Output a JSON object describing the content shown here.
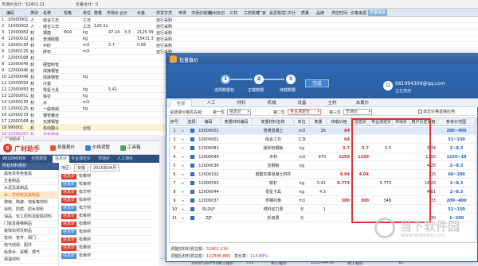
{
  "colors": {
    "accent": "#2d5a99",
    "highlight": "#e0342e",
    "red": "#d02424",
    "blue": "#1f5fbf"
  },
  "bg": {
    "status_left": "市场价合计：52401.21",
    "status_mid": "价差合计：0",
    "headers": [
      "",
      "编码",
      "类别",
      "名称",
      "规格",
      "单位",
      "数量",
      "市场价",
      "合价",
      "价差",
      "供货方式",
      "甲供",
      "市场价锁定",
      "输出标记",
      "三材",
      "三材系数",
      "厂家",
      "是否暂估",
      "二次分",
      "质量",
      "品牌",
      "供应时间",
      "价格来源"
    ],
    "highlight_header": "质量等级",
    "rows": [
      [
        "1",
        "10000001",
        "人",
        "综合工日",
        "",
        "工日",
        "",
        "",
        "",
        "",
        "自行采购"
      ],
      [
        "2",
        "11000002",
        "人",
        "综合工日",
        "",
        "工日",
        "120.31",
        "",
        "",
        "",
        "自行采购"
      ],
      [
        "3",
        "12000082",
        "材",
        "钢筋",
        "Φ10",
        "kg",
        "",
        "47.24",
        "3.3",
        "2125.39",
        "自行采购"
      ],
      [
        "4",
        "12000032",
        "材",
        "普通硅酸",
        "",
        "kg",
        "",
        "",
        "",
        "13431.3",
        "自行采购"
      ],
      [
        "5",
        "12000130",
        "材",
        "中砂",
        "",
        "m3",
        "",
        "5.7",
        "",
        "0.68",
        "自行采购"
      ],
      [
        "6",
        "12000125",
        "材",
        "碎石",
        "",
        "m3",
        "",
        "",
        "",
        "",
        "自行采购"
      ],
      [
        "7",
        "12000168",
        "材",
        "",
        "",
        "",
        "",
        "",
        "",
        "",
        ""
      ],
      [
        "8",
        "12000045",
        "材",
        "硬塑料管",
        "",
        "",
        "",
        "",
        "",
        "",
        ""
      ],
      [
        "9",
        "12000046",
        "材",
        "焊接钢管",
        "",
        "",
        "",
        "",
        "",
        "",
        ""
      ],
      [
        "10",
        "12000046",
        "材",
        "焊接钢管",
        "",
        "kg",
        "",
        "",
        "",
        "",
        ""
      ],
      [
        "11",
        "12000050",
        "材",
        "冷拔",
        "",
        "",
        "",
        "",
        "",
        "",
        ""
      ],
      [
        "12",
        "12000050",
        "材",
        "零星卡具",
        "",
        "kg",
        "",
        "5.41",
        "",
        "",
        ""
      ],
      [
        "13",
        "12000051",
        "材",
        "铁钉",
        "",
        "kg",
        "",
        "",
        "",
        "",
        ""
      ],
      [
        "14",
        "12000130",
        "材",
        "水",
        "",
        "m3",
        "",
        "",
        "",
        "",
        ""
      ],
      [
        "15",
        "12000125",
        "材",
        "一般电焊",
        "",
        "kg",
        "",
        "",
        "",
        "",
        ""
      ],
      [
        "16",
        "12000170",
        "材",
        "钢管螺丝",
        "",
        "",
        "",
        "",
        "",
        "",
        ""
      ],
      [
        "17",
        "12000168",
        "材",
        "支撑钢管",
        "",
        "",
        "",
        "",
        "",
        "",
        ""
      ],
      [
        "18",
        "990001",
        "机",
        "机动翻斗",
        "",
        "台班",
        "",
        "",
        "",
        "",
        ""
      ],
      [
        "19",
        "10000167",
        "机",
        "灰浆搅拌",
        "",
        "",
        "",
        "",
        "",
        "",
        ""
      ]
    ]
  },
  "guangcai": {
    "tab": "广材助手",
    "logo_text": "G",
    "title": "广材助手",
    "buttons": [
      {
        "label": "批量载价",
        "icon": "up-icon",
        "color": "#e05a2a"
      },
      {
        "label": "价格调整",
        "icon": "adjust-icon",
        "color": "#3a83d1"
      },
      {
        "label": "工具箱",
        "icon": "toolbox-icon",
        "color": "#4ba55a"
      }
    ],
    "user": "981094309",
    "nav": [
      "全部类型",
      "信息价",
      "专业测定价",
      "市场价",
      "人工询价"
    ],
    "nav_active": 1,
    "side_head": "所有材料类别",
    "side_items": [
      "黑色及有色金属",
      "五金制品",
      "水泥及其制品",
      "木、竹材料及其制品",
      "玻璃、陶瓷、地板等材料",
      "涂料、防腐、防水材料",
      "油品、化工原料及胶粘材料",
      "门窗及楼梯制品",
      "装饰石材及制品",
      "管材、管件、阀门",
      "电气线缆、配件",
      "给排水、采暖、燃气",
      "保温材料"
    ],
    "side_active": 3,
    "filter_label": "地区：",
    "filter_region": "安徽",
    "filter_period": "2015年04月",
    "products": [
      {
        "tag": "信息价",
        "name": "松橡材"
      },
      {
        "tag": "信息价",
        "name": "松板材"
      },
      {
        "tag": "信息价",
        "name": "松方材"
      },
      {
        "tag": "信息价",
        "name": "松杂材"
      },
      {
        "tag": "信息价",
        "name": "松方材"
      },
      {
        "tag": "信息价",
        "name": "松板材"
      },
      {
        "tag": "信息价",
        "name": "松橡材"
      },
      {
        "tag": "信息价",
        "name": "松杂材"
      },
      {
        "tag": "信息价",
        "name": "松橡材"
      },
      {
        "tag": "信息价",
        "name": "松橡材"
      },
      {
        "tag": "信息价",
        "name": "松板材"
      }
    ]
  },
  "dialog": {
    "title": "批量载价",
    "steps": [
      {
        "num": "1",
        "label": "选择数据包",
        "state": "done"
      },
      {
        "num": "2",
        "label": "正载数据",
        "state": "current"
      },
      {
        "num": "3",
        "label": "待载数据",
        "state": "todo"
      }
    ],
    "finish": "完成",
    "account": {
      "avatar": "Q",
      "email": "981094309@qq.com",
      "status": "正在使用"
    },
    "tabs": [
      "全部",
      "人工",
      "材料",
      "机械",
      "设备",
      "主材",
      "未载价"
    ],
    "tab_active": 0,
    "toolbar": {
      "label": "请选择价格优先级：",
      "p1_label": "第一优",
      "p1_value": "信息价",
      "p2_label": "第二优",
      "p2_value": "专业测定价",
      "p3_label": "第三优",
      "p3_value": "市场价",
      "check_label": "单击价格直接应用"
    },
    "columns": [
      "序号",
      "",
      "选择",
      "编码",
      "变量材料编码",
      "变量材料名称",
      "单位",
      "数量",
      "待载价格",
      "信息价",
      "专业测定价",
      "市场价",
      "用户历史价格",
      "参考价范围"
    ],
    "rows": [
      {
        "n": "1",
        "chk": true,
        "sel": true,
        "code": "15000001",
        "name": "普通混凝土",
        "unit": "m3",
        "qty": "26",
        "pend": "64",
        "info": "",
        "prof": "",
        "mkt": "",
        "hist": "",
        "range": "200~400"
      },
      {
        "n": "2",
        "chk": true,
        "sel": true,
        "code": "10000001",
        "name": "综合工日",
        "unit": "工日",
        "qty": "",
        "pend": "64",
        "info": "",
        "prof": "",
        "mkt": "",
        "hist": "",
        "range": "51~150"
      },
      {
        "n": "3",
        "chk": true,
        "sel": true,
        "code": "12000082",
        "name": "硅砂粉钢板",
        "unit": "kg",
        "qty": "",
        "pend": "5.7",
        "info": "5.7",
        "prof": "5.5",
        "mkt": "",
        "hist": "3.74",
        "range": "2~8.3"
      },
      {
        "n": "4",
        "chk": true,
        "sel": true,
        "code": "12000046",
        "name": "木材",
        "unit": "m3",
        "qty": "970",
        "pend": "1250",
        "info": "1250",
        "prof": "",
        "mkt": "",
        "hist": "1250",
        "range": "1250~18"
      },
      {
        "n": "5",
        "chk": true,
        "sel": true,
        "code": "12000036",
        "name": "宝钢板",
        "unit": "kg",
        "qty": "",
        "pend": "",
        "info": "",
        "prof": "",
        "mkt": "",
        "hist": "4.25",
        "range": "2~8.3"
      },
      {
        "n": "6",
        "chk": true,
        "sel": true,
        "code": "12000102",
        "name": "钢筋支撑混凝土构件",
        "unit": "",
        "qty": "",
        "pend": "4.04",
        "info": "4.04",
        "prof": "",
        "mkt": "",
        "hist": "115",
        "range": "60~200"
      },
      {
        "n": "7",
        "chk": true,
        "sel": true,
        "code": "12000555",
        "name": "铁钉",
        "unit": "kg",
        "qty": "5.41",
        "pend": "9.773",
        "info": "",
        "prof": "9.773",
        "mkt": "",
        "hist": "14.23",
        "range": "2~8.3"
      },
      {
        "n": "8",
        "chk": true,
        "sel": true,
        "code": "12000044",
        "name": "零星卡具",
        "unit": "kg",
        "qty": "4.5",
        "pend": "",
        "info": "",
        "prof": "",
        "mkt": "",
        "hist": "4.81",
        "range": "2~8.3"
      },
      {
        "n": "9",
        "chk": true,
        "sel": true,
        "code": "12000037",
        "name": "零钢托板",
        "unit": "m3",
        "qty": "",
        "pend": "300",
        "info": "300",
        "prof": "348",
        "mkt": "",
        "hist": "33",
        "range": "200~400"
      },
      {
        "n": "10",
        "chk": true,
        "sel": true,
        "code": "RLDLF",
        "name": "燃料动力费",
        "unit": "元",
        "qty": "1",
        "pend": "",
        "info": "",
        "prof": "",
        "mkt": "",
        "hist": "",
        "range": "51~150"
      },
      {
        "n": "11",
        "chk": true,
        "sel": true,
        "code": "ZJF",
        "name": "折旧费",
        "unit": "元",
        "qty": "",
        "pend": "",
        "info": "",
        "prof": "",
        "mkt": "",
        "hist": "30",
        "range": "1~200"
      }
    ],
    "footer": {
      "l1_label": "调整前材料费总额：",
      "l1_value": "52401.214",
      "l2_label": "调整后材料费总额：",
      "l2_value": "112586.885",
      "l2_rate_label": "变化率：",
      "l2_rate_value": "114.86%"
    }
  },
  "statusbar": [
    "2000*200*50到工程价",
    "m3",
    "到工程价",
    "2015-04-30",
    "到工程价",
    "95"
  ],
  "watermark": {
    "text": "当下软件园",
    "url": "www.downxia.com"
  }
}
